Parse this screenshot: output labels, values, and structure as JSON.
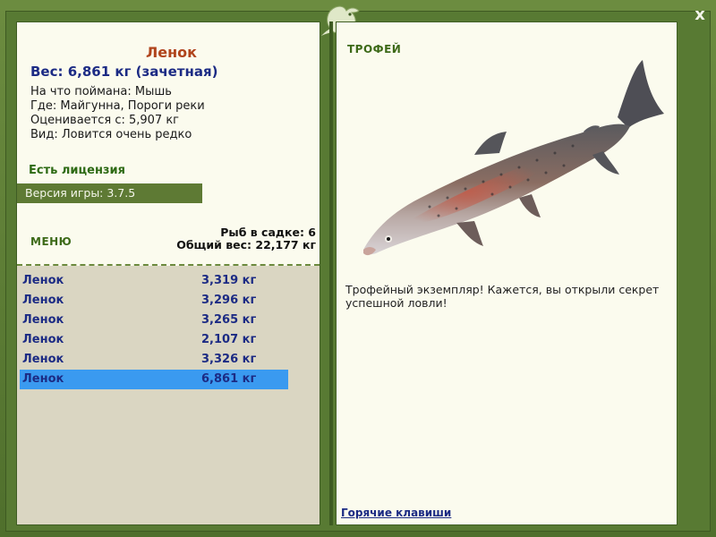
{
  "window": {
    "close_label": "x"
  },
  "fish": {
    "title": "Ленок",
    "weight_line": "Вес: 6,861 кг (зачетная)",
    "caught_with": "На что поймана: Мышь",
    "location": "Где: Майгунна, Пороги реки",
    "valued_from": "Оценивается с: 5,907 кг",
    "rarity": "Вид: Ловится очень редко"
  },
  "license_text": "Есть лицензия",
  "version_text": "Версия игры: 3.7.5",
  "menu_label": "МЕНЮ",
  "cage": {
    "count_line": "Рыб в садке: 6",
    "total_line": "Общий вес: 22,177 кг"
  },
  "catch_list": [
    {
      "name": "Ленок",
      "weight": "3,319 кг",
      "selected": false
    },
    {
      "name": "Ленок",
      "weight": "3,296 кг",
      "selected": false
    },
    {
      "name": "Ленок",
      "weight": "3,265 кг",
      "selected": false
    },
    {
      "name": "Ленок",
      "weight": "2,107 кг",
      "selected": false
    },
    {
      "name": "Ленок",
      "weight": "3,326 кг",
      "selected": false
    },
    {
      "name": "Ленок",
      "weight": "6,861 кг",
      "selected": true
    }
  ],
  "trophy": {
    "label": "ТРОФЕЙ",
    "message": "Трофейный экземпляр! Кажется, вы открыли секрет успешной ловли!"
  },
  "hotkeys_label": "Горячие клавиши",
  "colors": {
    "frame_green": "#587a33",
    "panel_bg": "#fbfbee",
    "list_bg": "#dad6c2",
    "selected_row": "#3a9af0",
    "title_orange": "#b0441c",
    "navy_text": "#1c2b84",
    "green_label": "#3d6a18"
  }
}
